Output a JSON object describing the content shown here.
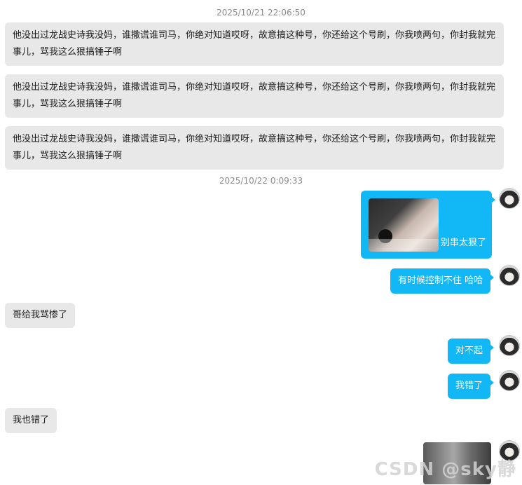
{
  "timestamps": [
    "2025/10/21 22:06:50",
    "2025/10/22 0:09:33"
  ],
  "messages": {
    "m1": "他没出过龙战史诗我没妈，谁撒谎谁司马，你绝对知道哎呀，故意搞这种号，你还给这个号刷，你我喷两句，你封我就完事儿，骂我这么狠搞锤子啊",
    "m2": "他没出过龙战史诗我没妈，谁撒谎谁司马，你绝对知道哎呀，故意搞这种号，你还给这个号刷，你我喷两句，你封我就完事儿，骂我这么狠搞锤子啊",
    "m3": "他没出过龙战史诗我没妈，谁撒谎谁司马，你绝对知道哎呀，故意搞这种号，你还给这个号刷，你我喷两句，你封我就完事儿，骂我这么狠搞锤子啊",
    "m4_caption": "别串太狠了",
    "m5": "有时候控制不住 哈哈",
    "m6": "哥给我骂惨了",
    "m7": "对不起",
    "m8": "我错了",
    "m9": "我也错了"
  },
  "watermark": "CSDN @sky静",
  "colors": {
    "outgoing": "#12b7f5",
    "incoming": "#e8e8e8",
    "timestamp": "#8c8c8c"
  }
}
